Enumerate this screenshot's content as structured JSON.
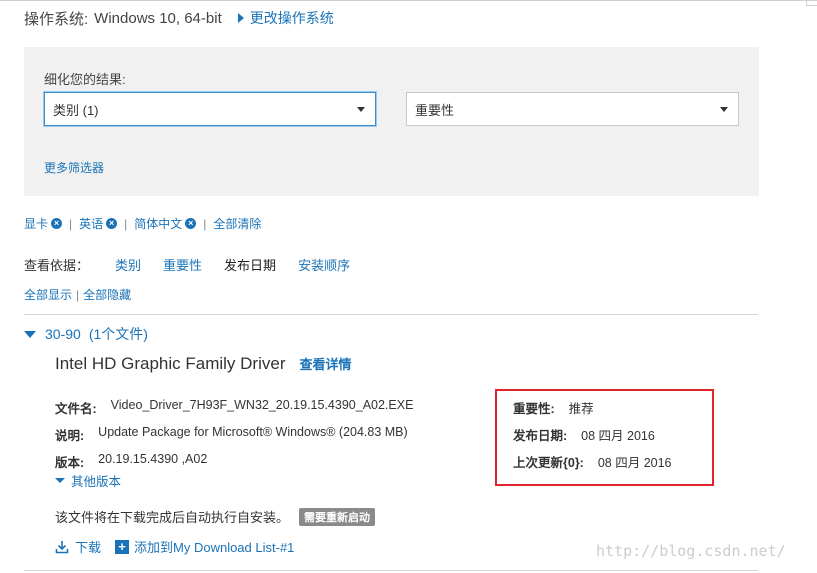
{
  "os": {
    "label": "操作系统:",
    "value": "Windows 10, 64-bit",
    "change_link": "更改操作系统"
  },
  "filters": {
    "refine_label": "细化您的结果:",
    "category_select": "类别 (1)",
    "importance_select": "重要性",
    "more_filters": "更多筛选器"
  },
  "active_filters": {
    "chips": [
      {
        "label": "显卡"
      },
      {
        "label": "英语"
      },
      {
        "label": "简体中文"
      }
    ],
    "clear_all": "全部清除"
  },
  "sort": {
    "label": "查看依据：",
    "options": [
      "类别",
      "重要性",
      "发布日期",
      "安装顺序"
    ],
    "current": "发布日期"
  },
  "expand": {
    "show_all": "全部显示",
    "hide_all": "全部隐藏"
  },
  "group": {
    "title": "30-90",
    "count": "(1个文件)"
  },
  "driver": {
    "name": "Intel HD Graphic Family Driver",
    "details_link": "查看详情",
    "file_name_label": "文件名:",
    "file_name": "Video_Driver_7H93F_WN32_20.19.15.4390_A02.EXE",
    "description_label": "说明:",
    "description": "Update Package for Microsoft® Windows® (204.83 MB)",
    "version_label": "版本:",
    "version": "20.19.15.4390 ,A02",
    "other_versions": "其他版本",
    "importance_label": "重要性:",
    "importance": "推荐",
    "release_date_label": "发布日期:",
    "release_date": "08 四月 2016",
    "last_updated_label": "上次更新{0}:",
    "last_updated": "08 四月 2016",
    "install_note": "该文件将在下载完成后自动执行自安装。",
    "restart_badge": "需要重新启动",
    "download": "下载",
    "add_to_list": "添加到My Download List-#1"
  },
  "watermark": "http://blog.csdn.net/",
  "colors": {
    "link": "#1a73b8",
    "highlight": "#e0242b",
    "panel": "#f1f1f1"
  }
}
